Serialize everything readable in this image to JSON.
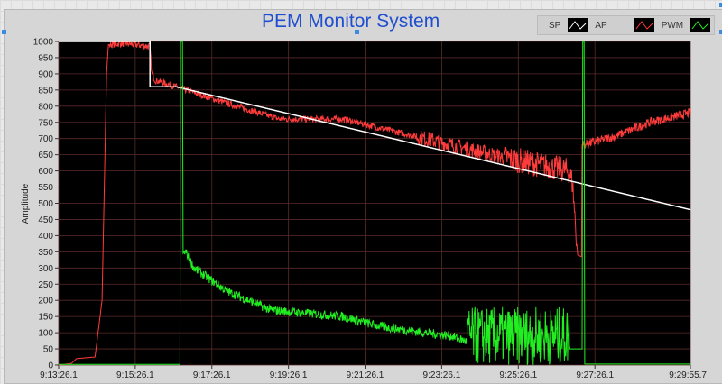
{
  "title": "PEM Monitor System",
  "chart_data": {
    "type": "line",
    "title": "PEM Monitor System",
    "xlabel": "",
    "ylabel": "Amplitude",
    "ylim": [
      0,
      1000
    ],
    "yticks": [
      0,
      50,
      100,
      150,
      200,
      250,
      300,
      350,
      400,
      450,
      500,
      550,
      600,
      650,
      700,
      750,
      800,
      850,
      900,
      950,
      1000
    ],
    "x_unit": "seconds since 9:13:26.1",
    "xlim": [
      0,
      989.6
    ],
    "xticks": [
      0,
      120,
      240,
      360,
      480,
      600,
      720,
      840,
      989.6
    ],
    "xtick_labels": [
      "9:13:26.1",
      "9:15:26.1",
      "9:17:26.1",
      "9:19:26.1",
      "9:21:26.1",
      "9:23:26.1",
      "9:25:26.1",
      "9:27:26.1",
      "9:29:55.7"
    ],
    "grid": true,
    "legend_position": "top-right",
    "series": [
      {
        "name": "SP",
        "color": "#ffffff",
        "points": [
          [
            0,
            1000
          ],
          [
            143,
            1000
          ],
          [
            143,
            860
          ],
          [
            184,
            860
          ],
          [
            990,
            480
          ]
        ]
      },
      {
        "name": "AP",
        "color": "#ff3b3b",
        "points": [
          [
            0,
            0
          ],
          [
            20,
            5
          ],
          [
            28,
            20
          ],
          [
            57,
            25
          ],
          [
            68,
            200
          ],
          [
            75,
            900
          ],
          [
            78,
            990
          ],
          [
            100,
            995
          ],
          [
            143,
            985
          ],
          [
            146,
            900
          ],
          [
            151,
            880
          ],
          [
            184,
            860
          ],
          [
            262,
            810
          ],
          [
            346,
            760
          ],
          [
            445,
            760
          ],
          [
            573,
            700
          ],
          [
            679,
            650
          ],
          [
            799,
            600
          ],
          [
            805,
            560
          ],
          [
            813,
            340
          ],
          [
            819,
            335
          ],
          [
            820,
            680
          ],
          [
            869,
            705
          ],
          [
            926,
            750
          ],
          [
            990,
            780
          ]
        ]
      },
      {
        "name": "PWM",
        "color": "#22ee22",
        "points": [
          [
            0,
            2
          ],
          [
            190,
            2
          ],
          [
            191,
            1000
          ],
          [
            194,
            1000
          ],
          [
            195,
            345
          ],
          [
            199,
            350
          ],
          [
            212,
            300
          ],
          [
            262,
            230
          ],
          [
            332,
            170
          ],
          [
            445,
            150
          ],
          [
            502,
            120
          ],
          [
            573,
            100
          ],
          [
            615,
            90
          ],
          [
            643,
            70
          ],
          [
            671,
            60
          ],
          [
            800,
            60
          ],
          [
            801,
            50
          ],
          [
            820,
            50
          ],
          [
            821,
            1000
          ],
          [
            823,
            1000
          ],
          [
            824,
            3
          ],
          [
            990,
            3
          ]
        ]
      }
    ]
  }
}
